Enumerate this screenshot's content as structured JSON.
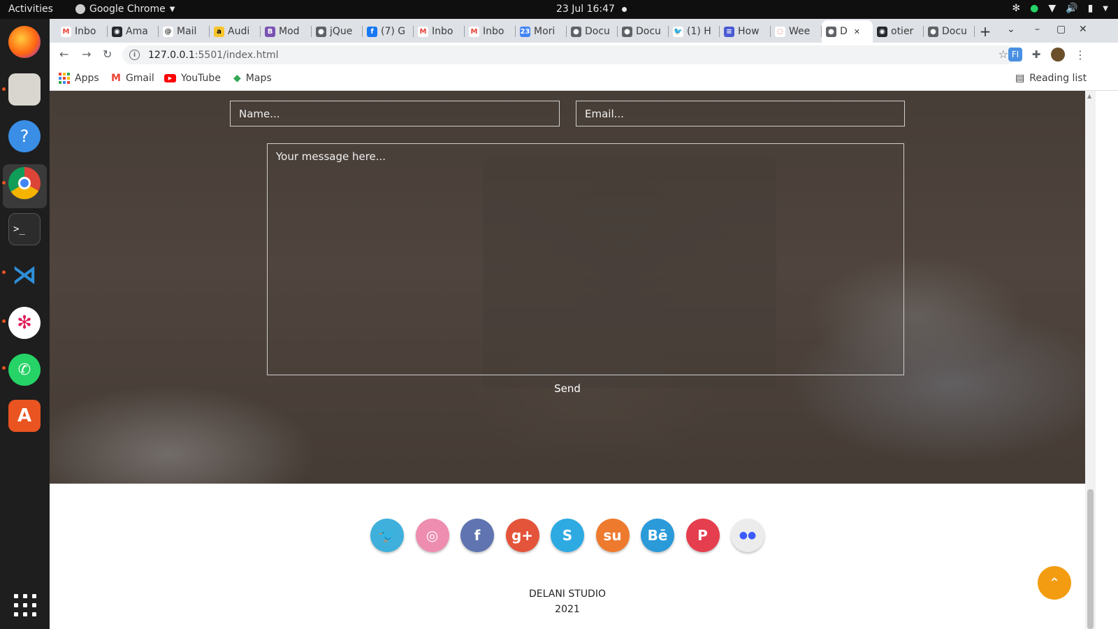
{
  "system": {
    "activities": "Activities",
    "app_name": "Google Chrome",
    "clock": "23 Jul  16:47"
  },
  "dock": {
    "items": [
      "firefox",
      "files",
      "help",
      "chrome",
      "terminal",
      "vscode",
      "slack",
      "whatsapp",
      "software-center"
    ]
  },
  "browser": {
    "tabs": [
      {
        "label": "Inbo",
        "icon": "gmail-icon"
      },
      {
        "label": "Ama",
        "icon": "github-icon"
      },
      {
        "label": "Mail",
        "icon": "mail-icon"
      },
      {
        "label": "Audi",
        "icon": "audible-icon"
      },
      {
        "label": "Mod",
        "icon": "bootstrap-icon"
      },
      {
        "label": "jQue",
        "icon": "globe-icon"
      },
      {
        "label": "(7) G",
        "icon": "facebook-icon"
      },
      {
        "label": "Inbo",
        "icon": "gmail-icon"
      },
      {
        "label": "Inbo",
        "icon": "gmail-icon"
      },
      {
        "label": "Mori",
        "icon": "calendar-icon"
      },
      {
        "label": "Docu",
        "icon": "globe-icon"
      },
      {
        "label": "Docu",
        "icon": "globe-icon"
      },
      {
        "label": "(1) H",
        "icon": "twitter-icon"
      },
      {
        "label": "How",
        "icon": "docs-icon"
      },
      {
        "label": "Wee",
        "icon": "record-icon"
      },
      {
        "label": "D",
        "icon": "globe-icon",
        "active": true
      },
      {
        "label": "otier",
        "icon": "github-icon"
      },
      {
        "label": "Docu",
        "icon": "globe-icon"
      }
    ],
    "new_tab": "+",
    "url_host": "127.0.0.1",
    "url_rest": ":5501/index.html",
    "bookmarks": [
      "Apps",
      "Gmail",
      "YouTube",
      "Maps"
    ],
    "reading_list": "Reading list"
  },
  "form": {
    "name_placeholder": "Name...",
    "email_placeholder": "Email...",
    "message_placeholder": "Your message here...",
    "send_label": "Send"
  },
  "social": [
    {
      "name": "twitter",
      "glyph": "🐦",
      "color": "#3fb0dc"
    },
    {
      "name": "dribbble",
      "glyph": "◎",
      "color": "#ee8db0"
    },
    {
      "name": "facebook",
      "glyph": "f",
      "color": "#5f74b0"
    },
    {
      "name": "google-plus",
      "glyph": "g+",
      "color": "#e4543b"
    },
    {
      "name": "skype",
      "glyph": "S",
      "color": "#2eaae3"
    },
    {
      "name": "stumbleupon",
      "glyph": "su",
      "color": "#ee7a2e"
    },
    {
      "name": "behance",
      "glyph": "Bē",
      "color": "#2a9ad9"
    },
    {
      "name": "pinterest",
      "glyph": "P",
      "color": "#e53e4e"
    },
    {
      "name": "flickr",
      "glyph": "●●",
      "color": "#ececec"
    }
  ],
  "footer": {
    "studio": "DELANI STUDIO",
    "year": "2021"
  },
  "colors": {
    "accent_orange": "#f39c12",
    "chrome_frame": "#dee1e6"
  }
}
